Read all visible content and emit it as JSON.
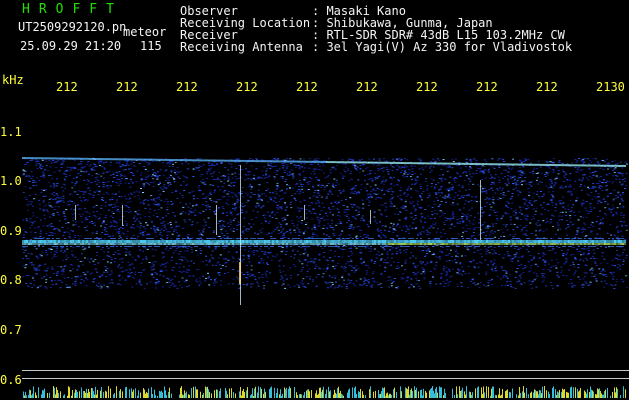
{
  "header": {
    "brand": "HROFFT",
    "file_name": "UT2509292120.pn",
    "label_meteor": "meteor",
    "timestamp": "25.09.29 21:20",
    "count": "115",
    "observer_label": "Observer",
    "observer_value": ": Masaki Kano",
    "location_label": "Receiving Location",
    "location_value": ": Shibukawa, Gunma, Japan",
    "receiver_label": "Receiver",
    "receiver_value": ": RTL-SDR SDR# 43dB L15 103.2MHz CW",
    "antenna_label": "Receiving Antenna",
    "antenna_value": ": 3el Yagi(V) Az 330 for Vladivostok"
  },
  "axis": {
    "unit": "kHz",
    "time_ticks": [
      "212",
      "212",
      "212",
      "212",
      "212",
      "212",
      "212",
      "212",
      "212",
      "2130"
    ],
    "freq_ticks": [
      "1.1",
      "1.0",
      "0.9",
      "0.8",
      "0.7",
      "0.6"
    ]
  },
  "colors": {
    "header_green": "#22e000",
    "header_white": "#f4f4f4",
    "tick_yellow": "#ffff3a",
    "band_cyan": "#50d8ff",
    "noise_blue": "#1a3cff"
  }
}
